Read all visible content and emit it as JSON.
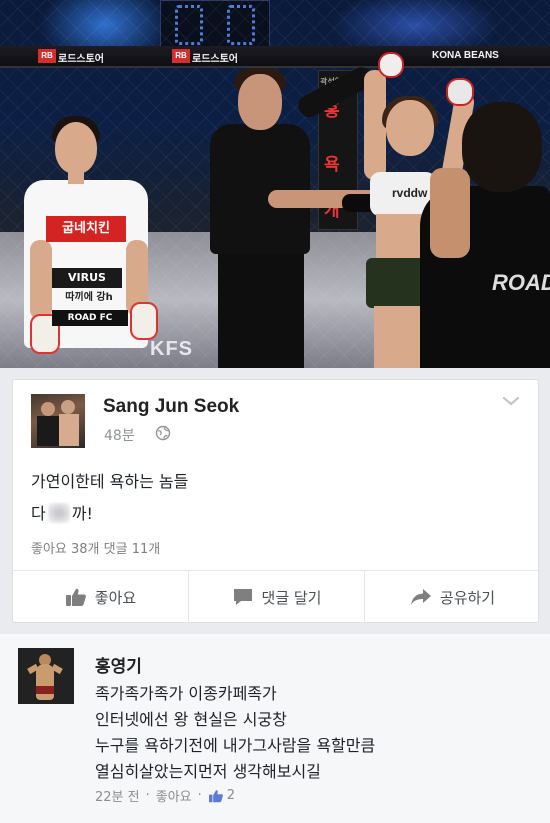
{
  "photo": {
    "rail_sponsor_left": "로드스토어",
    "rail_sponsor_mid": "로드스토어",
    "rail_sponsor_right": "KONA BEANS",
    "banner_name": "곽성억",
    "banner_chars": [
      "홍",
      "욕",
      "개"
    ],
    "floor_logo": "KFS",
    "fighter1_shirt": [
      "굽네치킨",
      "VIRUS",
      "따끼에 강h",
      "ROAD FC"
    ],
    "fighter2_top": "rvddw",
    "camera_shirt": "ROAD"
  },
  "post": {
    "author": "Sang Jun Seok",
    "time": "48분",
    "line1": "가연이한테 욕하는 놈들",
    "line2_prefix": "다",
    "line2_suffix": "까!",
    "stats": "좋아요 38개  댓글 11개",
    "actions": {
      "like": "좋아요",
      "comment": "댓글 달기",
      "share": "공유하기"
    }
  },
  "comment": {
    "author": "홍영기",
    "lines": [
      "족가족가족가 이종카페족가",
      "인터넷에선 왕 현실은 시궁창",
      "누구를 욕하기전에 내가그사람을 욕할만큼",
      "열심히살았는지먼저 생각해보시길"
    ],
    "time": "22분 전",
    "like_label": "좋아요",
    "like_count": "2"
  },
  "colors": {
    "page_bg": "#e9ebee",
    "card_bg": "#ffffff",
    "meta_text": "#90949c",
    "action_text": "#4b4f56"
  }
}
